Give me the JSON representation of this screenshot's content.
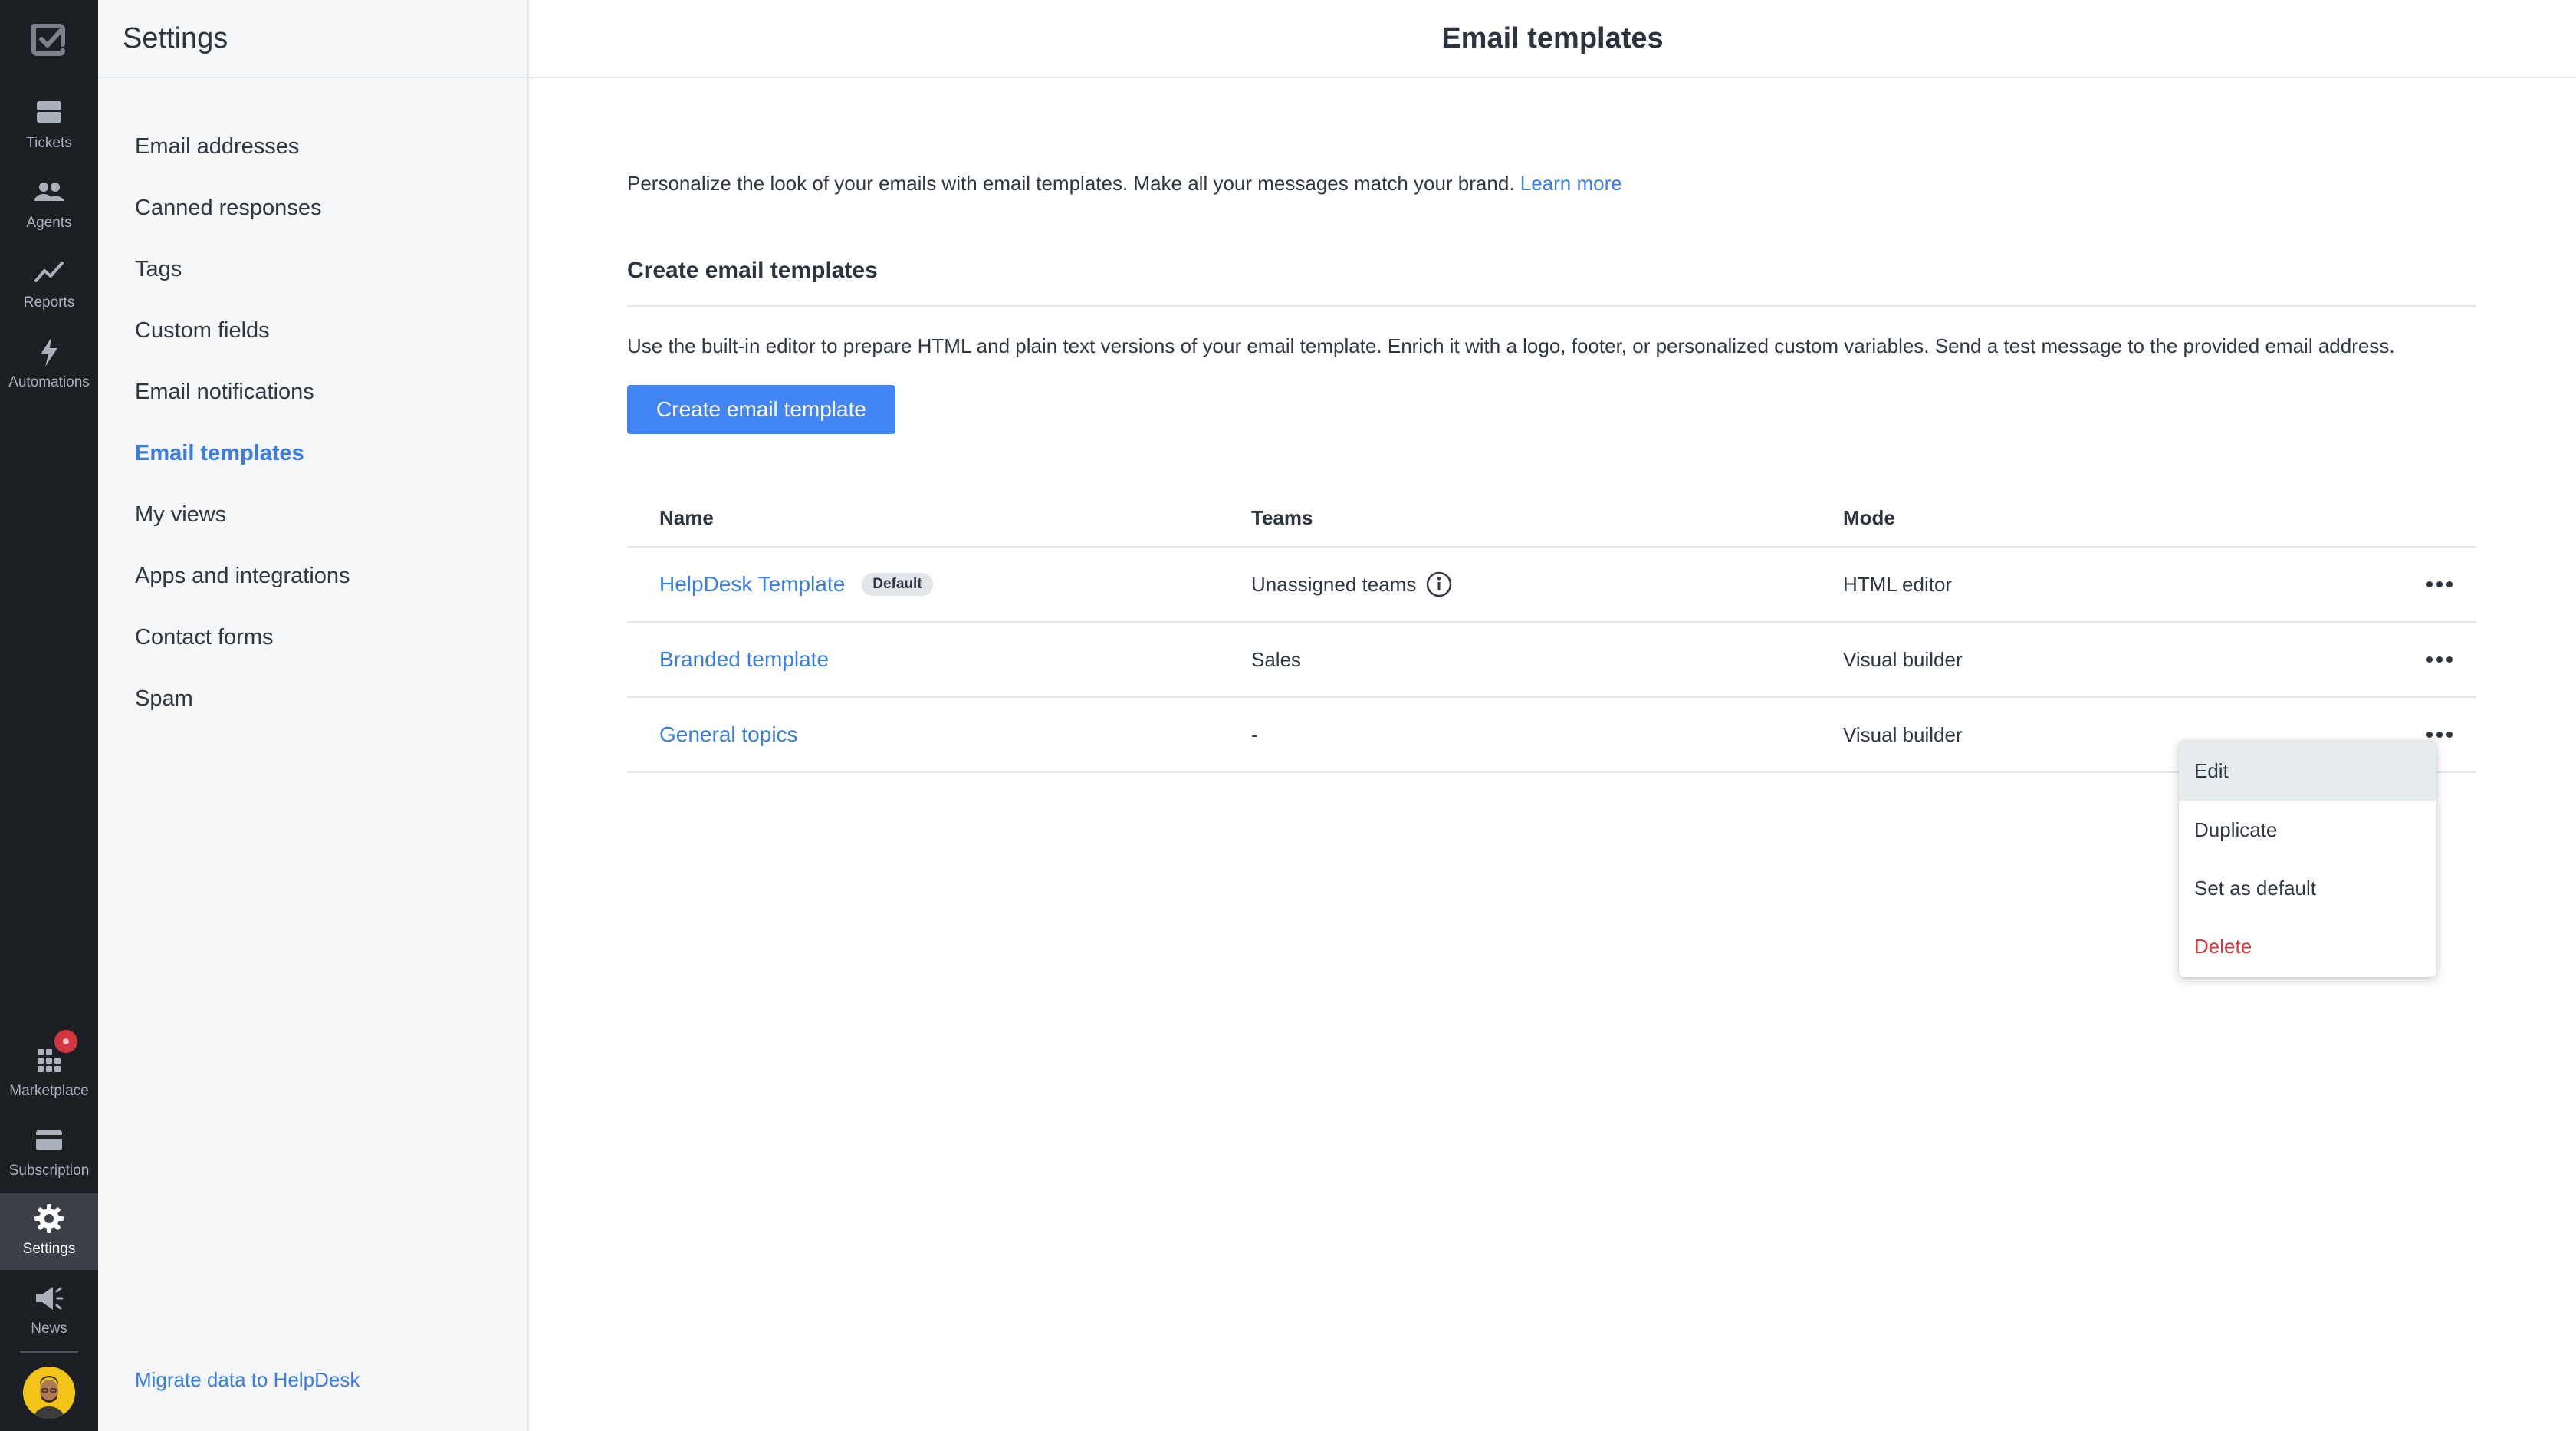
{
  "rail": {
    "items": [
      {
        "label": "Tickets",
        "icon": "tickets-icon"
      },
      {
        "label": "Agents",
        "icon": "agents-icon"
      },
      {
        "label": "Reports",
        "icon": "reports-icon"
      },
      {
        "label": "Automations",
        "icon": "automations-icon"
      },
      {
        "label": "Marketplace",
        "icon": "marketplace-icon"
      },
      {
        "label": "Subscription",
        "icon": "subscription-icon"
      },
      {
        "label": "Settings",
        "icon": "settings-icon"
      },
      {
        "label": "News",
        "icon": "news-icon"
      }
    ],
    "active": "Settings",
    "badge_color": "#d2373f"
  },
  "settings": {
    "title": "Settings",
    "items": [
      "Email addresses",
      "Canned responses",
      "Tags",
      "Custom fields",
      "Email notifications",
      "Email templates",
      "My views",
      "Apps and integrations",
      "Contact forms",
      "Spam"
    ],
    "active": "Email templates",
    "migrate_link": "Migrate data to HelpDesk"
  },
  "main": {
    "title": "Email templates",
    "intro": "Personalize the look of your emails with email templates. Make all your messages match your brand.",
    "learn_more": "Learn more",
    "section_title": "Create email templates",
    "section_desc": "Use the built-in editor to prepare HTML and plain text versions of your email template. Enrich it with a logo, footer, or personalized custom variables. Send a test message to the provided email address.",
    "create_button": "Create email template",
    "table": {
      "headers": {
        "name": "Name",
        "teams": "Teams",
        "mode": "Mode"
      },
      "rows": [
        {
          "name": "HelpDesk Template",
          "badge": "Default",
          "teams": "Unassigned teams",
          "mode": "HTML editor"
        },
        {
          "name": "Branded template",
          "teams": "Sales",
          "mode": "Visual builder"
        },
        {
          "name": "General topics",
          "teams": "-",
          "mode": "Visual builder"
        }
      ]
    },
    "menu": [
      "Edit",
      "Duplicate",
      "Set as default",
      "Delete"
    ]
  },
  "colors": {
    "accent": "#3a7de0",
    "button": "#4285f4",
    "danger": "#d2373f",
    "rail_bg": "#1c1f24"
  }
}
